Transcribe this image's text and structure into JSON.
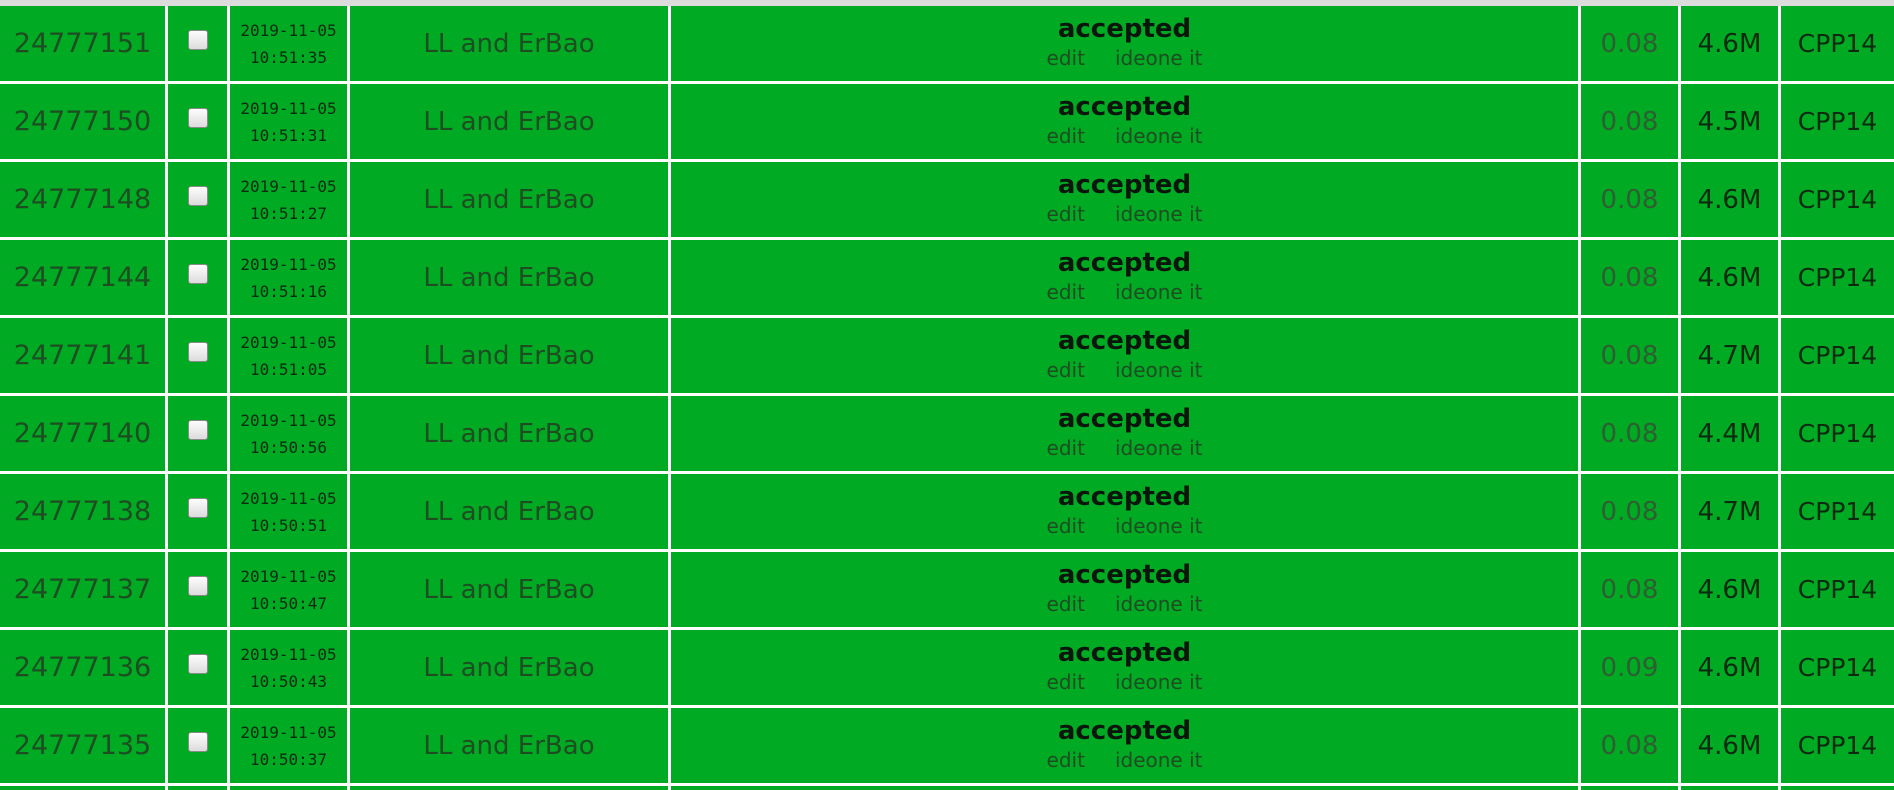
{
  "table": {
    "rows": [
      {
        "id": "24777151",
        "date": "2019-11-05",
        "time": "10:51:35",
        "user": "LL and ErBao",
        "verdict": "accepted",
        "edit": "edit",
        "ideone": "ideone it",
        "exec_time": "0.08",
        "memory": "4.6M",
        "lang": "CPP14"
      },
      {
        "id": "24777150",
        "date": "2019-11-05",
        "time": "10:51:31",
        "user": "LL and ErBao",
        "verdict": "accepted",
        "edit": "edit",
        "ideone": "ideone it",
        "exec_time": "0.08",
        "memory": "4.5M",
        "lang": "CPP14"
      },
      {
        "id": "24777148",
        "date": "2019-11-05",
        "time": "10:51:27",
        "user": "LL and ErBao",
        "verdict": "accepted",
        "edit": "edit",
        "ideone": "ideone it",
        "exec_time": "0.08",
        "memory": "4.6M",
        "lang": "CPP14"
      },
      {
        "id": "24777144",
        "date": "2019-11-05",
        "time": "10:51:16",
        "user": "LL and ErBao",
        "verdict": "accepted",
        "edit": "edit",
        "ideone": "ideone it",
        "exec_time": "0.08",
        "memory": "4.6M",
        "lang": "CPP14"
      },
      {
        "id": "24777141",
        "date": "2019-11-05",
        "time": "10:51:05",
        "user": "LL and ErBao",
        "verdict": "accepted",
        "edit": "edit",
        "ideone": "ideone it",
        "exec_time": "0.08",
        "memory": "4.7M",
        "lang": "CPP14"
      },
      {
        "id": "24777140",
        "date": "2019-11-05",
        "time": "10:50:56",
        "user": "LL and ErBao",
        "verdict": "accepted",
        "edit": "edit",
        "ideone": "ideone it",
        "exec_time": "0.08",
        "memory": "4.4M",
        "lang": "CPP14"
      },
      {
        "id": "24777138",
        "date": "2019-11-05",
        "time": "10:50:51",
        "user": "LL and ErBao",
        "verdict": "accepted",
        "edit": "edit",
        "ideone": "ideone it",
        "exec_time": "0.08",
        "memory": "4.7M",
        "lang": "CPP14"
      },
      {
        "id": "24777137",
        "date": "2019-11-05",
        "time": "10:50:47",
        "user": "LL and ErBao",
        "verdict": "accepted",
        "edit": "edit",
        "ideone": "ideone it",
        "exec_time": "0.08",
        "memory": "4.6M",
        "lang": "CPP14"
      },
      {
        "id": "24777136",
        "date": "2019-11-05",
        "time": "10:50:43",
        "user": "LL and ErBao",
        "verdict": "accepted",
        "edit": "edit",
        "ideone": "ideone it",
        "exec_time": "0.09",
        "memory": "4.6M",
        "lang": "CPP14"
      },
      {
        "id": "24777135",
        "date": "2019-11-05",
        "time": "10:50:37",
        "user": "LL and ErBao",
        "verdict": "accepted",
        "edit": "edit",
        "ideone": "ideone it",
        "exec_time": "0.08",
        "memory": "4.6M",
        "lang": "CPP14"
      }
    ]
  },
  "colors": {
    "row_background": "#00aa22",
    "separator": "#ffffff"
  },
  "icons": {
    "row_checkbox": "checkbox-icon"
  }
}
